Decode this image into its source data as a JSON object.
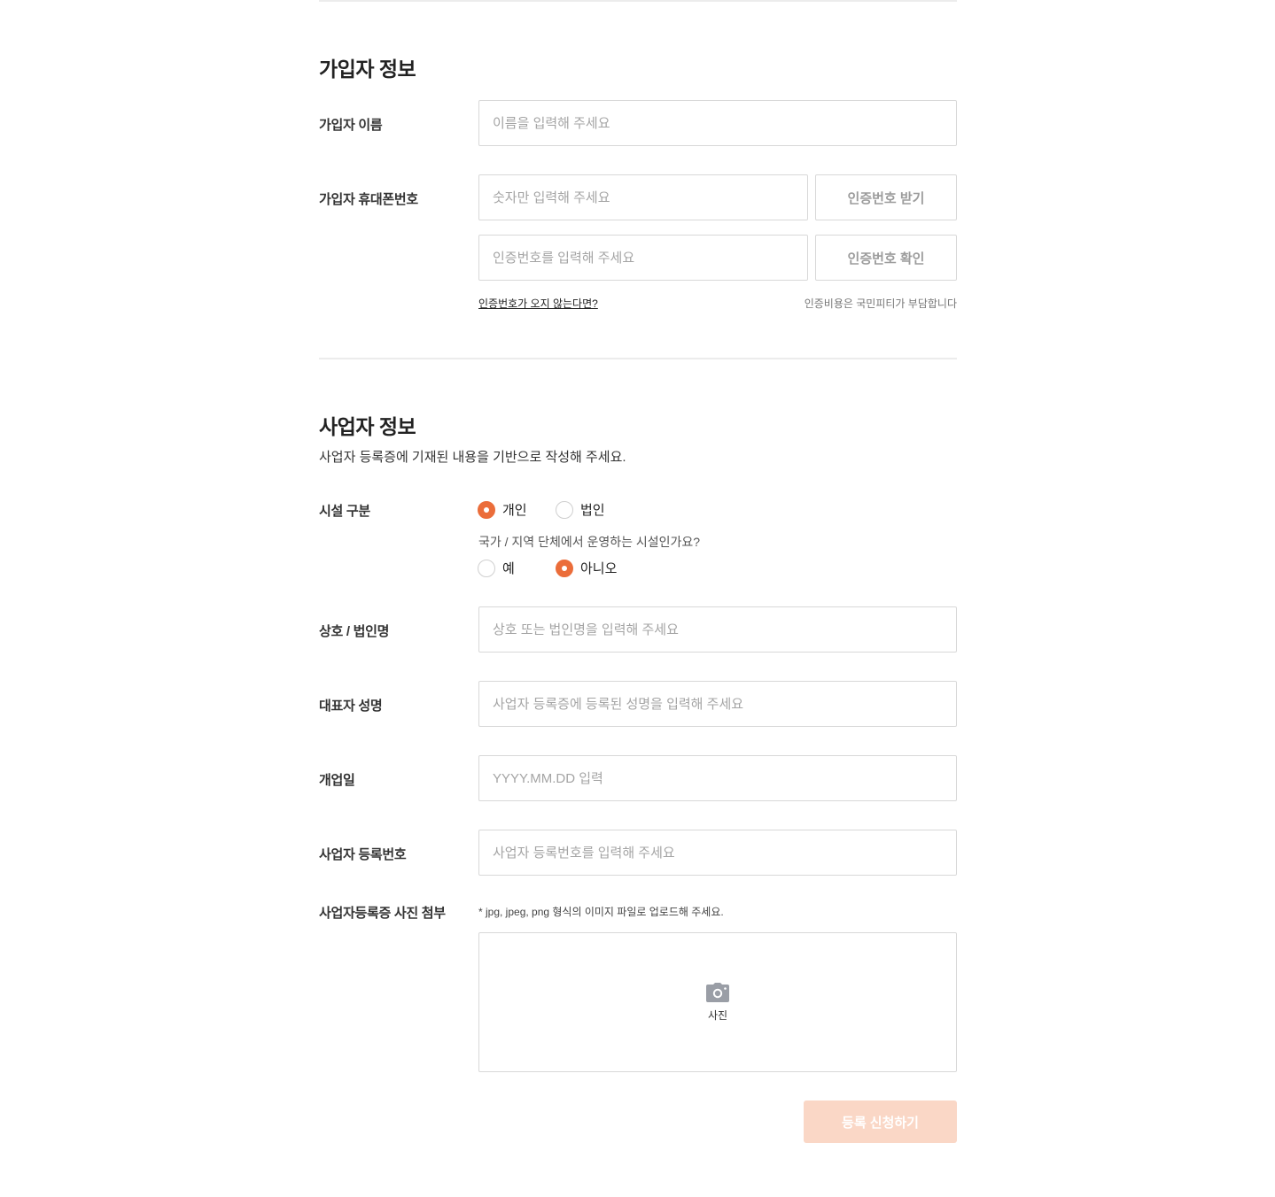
{
  "member": {
    "title": "가입자 정보",
    "name_label": "가입자 이름",
    "name_placeholder": "이름을 입력해 주세요",
    "phone_label": "가입자 휴대폰번호",
    "phone_placeholder": "숫자만 입력해 주세요",
    "send_code_button": "인증번호 받기",
    "code_placeholder": "인증번호를 입력해 주세요",
    "verify_code_button": "인증번호 확인",
    "no_code_link": "인증번호가 오지 않는다면?",
    "cost_note": "인증비용은 국민피티가 부담합니다"
  },
  "business": {
    "title": "사업자 정보",
    "description": "사업자 등록증에 기재된 내용을 기반으로 작성해 주세요.",
    "facility_label": "시설 구분",
    "facility_options": [
      {
        "label": "개인",
        "checked": true
      },
      {
        "label": "법인",
        "checked": false
      }
    ],
    "public_question": "국가 / 지역 단체에서 운영하는 시설인가요?",
    "public_options": [
      {
        "label": "예",
        "checked": false
      },
      {
        "label": "아니오",
        "checked": true
      }
    ],
    "company_label": "상호 / 법인명",
    "company_placeholder": "상호 또는 법인명을 입력해 주세요",
    "ceo_label": "대표자 성명",
    "ceo_placeholder": "사업자 등록증에 등록된 성명을 입력해 주세요",
    "open_date_label": "개업일",
    "open_date_placeholder": "YYYY.MM.DD 입력",
    "reg_number_label": "사업자 등록번호",
    "reg_number_placeholder": "사업자 등록번호를 입력해 주세요",
    "photo_label": "사업자등록증 사진 첨부",
    "photo_hint": "* jpg, jpeg, png 형식의 이미지 파일로 업로드해 주세요.",
    "photo_caption": "사진",
    "photo_icon": "camera-icon"
  },
  "submit_label": "등록 신청하기",
  "colors": {
    "accent": "#eb6d3a",
    "submit_disabled_bg": "#fad7c6",
    "border": "#d8d8d8"
  }
}
